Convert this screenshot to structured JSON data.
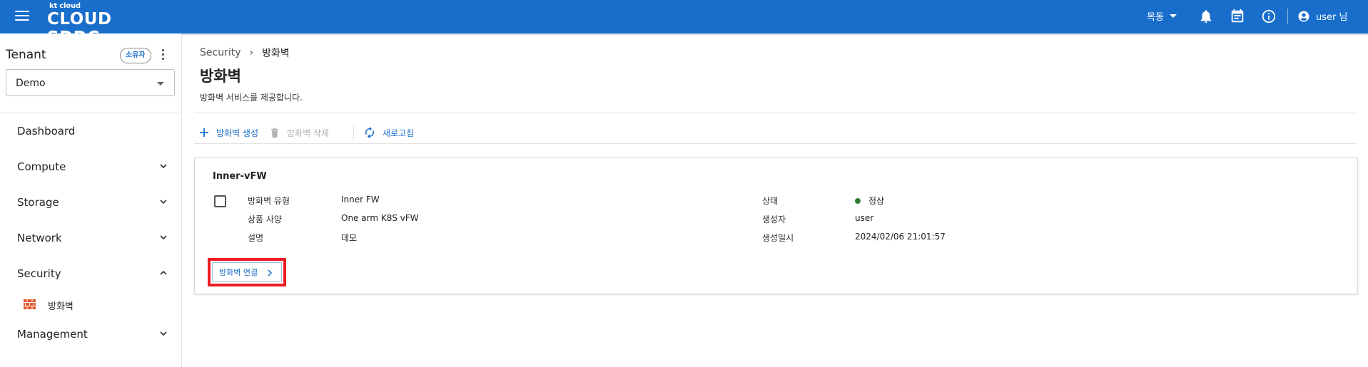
{
  "app": {
    "logo_small": "kt cloud",
    "logo_big": "CLOUD SDDC"
  },
  "topbar": {
    "region": "목동",
    "user_name": "user 님",
    "icons": [
      "menu-icon",
      "bell-icon",
      "calendar-icon",
      "info-icon",
      "account-circle-icon"
    ]
  },
  "sidebar": {
    "tenant_label": "Tenant",
    "owner_badge": "소유자",
    "tenant_selected": "Demo",
    "items": [
      {
        "label": "Dashboard",
        "expandable": false
      },
      {
        "label": "Compute",
        "expandable": true,
        "expanded": false
      },
      {
        "label": "Storage",
        "expandable": true,
        "expanded": false
      },
      {
        "label": "Network",
        "expandable": true,
        "expanded": false
      },
      {
        "label": "Security",
        "expandable": true,
        "expanded": true
      },
      {
        "label": "Management",
        "expandable": true,
        "expanded": false
      }
    ],
    "security_sub": {
      "label": "방화벽",
      "icon": "firewall-icon"
    }
  },
  "breadcrumb": {
    "parent": "Security",
    "current": "방화벽"
  },
  "page": {
    "title": "방화벽",
    "description": "방화벽 서비스를 제공합니다."
  },
  "toolbar": {
    "create": "방화벽 생성",
    "delete": "방화벽 삭제",
    "refresh": "새로고침"
  },
  "card": {
    "title": "Inner-vFW",
    "fields": {
      "type_label": "방화벽 유형",
      "type_value": "Inner FW",
      "spec_label": "상품 사양",
      "spec_value": "One arm K8S vFW",
      "desc_label": "설명",
      "desc_value": "데모",
      "status_label": "상태",
      "status_value": "정상",
      "creator_label": "생성자",
      "creator_value": "user",
      "created_label": "생성일시",
      "created_value": "2024/02/06 21:01:57"
    },
    "connect_button": "방화벽 연결"
  },
  "colors": {
    "topbar": "#1a6ecb",
    "accent": "#1a6ecb",
    "status_ok": "#2e7d32",
    "highlight": "#ee1c25",
    "firewall_icon": "#e8542b"
  }
}
